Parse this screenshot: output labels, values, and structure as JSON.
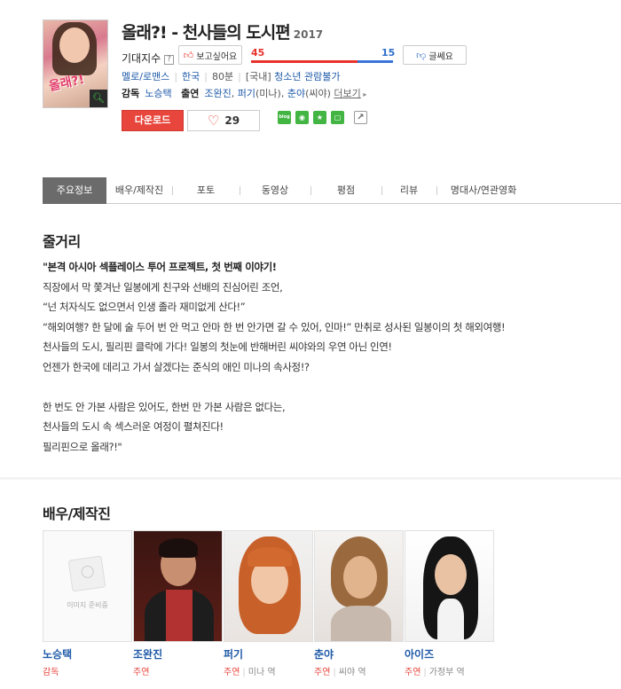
{
  "movie": {
    "title": "올래?! - 천사들의 도시편",
    "year": "2017",
    "poster_logo": "올래?!",
    "expect_label": "기대지수",
    "want_label": "보고싶어요",
    "meh_label": "글쎄요",
    "want_count": "45",
    "meh_count": "15",
    "want_fraction": 0.75,
    "genre": "멜로/로맨스",
    "country": "한국",
    "runtime": "80분",
    "rating_region": "[국내]",
    "rating": "청소년 관람불가",
    "director_label": "감독",
    "director": "노승택",
    "cast_label": "출연",
    "cast_list": [
      {
        "name": "조완진",
        "extra": ""
      },
      {
        "name": "퍼기",
        "extra": "(미나)"
      },
      {
        "name": "춘야",
        "extra": "(씨야)"
      }
    ],
    "more_label": "더보기",
    "download_label": "다운로드",
    "likes": "29"
  },
  "share": {
    "blog": "blog",
    "icons": [
      "band-icon",
      "star-icon",
      "square-icon"
    ]
  },
  "tabs": [
    "주요정보",
    "배우/제작진",
    "포토",
    "동영상",
    "평점",
    "리뷰",
    "명대사/연관영화"
  ],
  "synopsis": {
    "heading": "줄거리",
    "lead": "\"본격 아시아 섹플레이스 투어 프로젝트, 첫 번째 이야기!",
    "lines1": [
      "직장에서 막 쫓겨난 일봉에게 친구와 선배의 진심어린 조언,",
      " “넌 처자식도 없으면서 인생 졸라 재미없게 산다!”",
      " “해외여행? 한 달에 술 두어 번 안 먹고 안마 한 번 안가면 갈 수 있어, 인마!” 만취로 성사된 일봉이의 첫 해외여행!",
      " 천사들의 도시, 필리핀 클락에 가다! 일봉의 첫눈에 반해버린 씨야와의 우연 아닌 인연!",
      " 언젠가 한국에 데리고 가서 살겠다는 준식의 애인 미나의 속사정!?"
    ],
    "lines2": [
      " 한 번도 안 가본 사람은 있어도, 한번 만 가본 사람은 없다는,",
      " 천사들의 도시 속 섹스러운 여정이 펼쳐진다!",
      " 필리핀으로 올래?!\""
    ]
  },
  "cast_section": {
    "heading": "배우/제작진",
    "no_image_caption": "이미지 준비중",
    "people": [
      {
        "name": "노승택",
        "role": "감독",
        "character": ""
      },
      {
        "name": "조완진",
        "role": "주연",
        "character": ""
      },
      {
        "name": "퍼기",
        "role": "주연",
        "character": "미나 역"
      },
      {
        "name": "춘야",
        "role": "주연",
        "character": "씨야 역"
      },
      {
        "name": "아이즈",
        "role": "주연",
        "character": "가정부 역"
      }
    ]
  },
  "colors": {
    "accent_red": "#e8453c",
    "link_blue": "#1e5aa8",
    "active_tab": "#6b6b6b"
  }
}
